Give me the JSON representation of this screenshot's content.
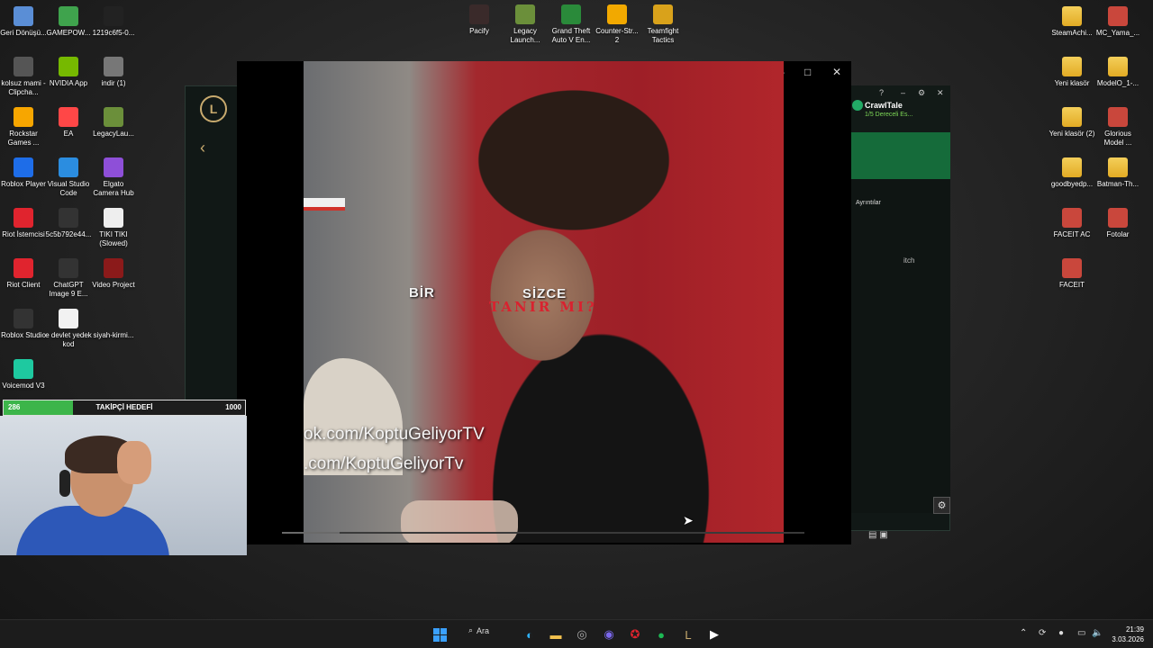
{
  "desktop_left": [
    {
      "label": "Geri Dönüşü...",
      "icon": "recycle-bin-icon",
      "color": "#5a8ed6"
    },
    {
      "label": "GAMEPOW...",
      "icon": "gamepow-icon",
      "color": "#3fa34d"
    },
    {
      "label": "1219c6f5-0...",
      "icon": "file-icon",
      "color": "#222222"
    },
    {
      "label": "kolsuz mami - Clipcha...",
      "icon": "video-file-icon",
      "color": "#555555"
    },
    {
      "label": "NVIDIA App",
      "icon": "nvidia-icon",
      "color": "#76b900"
    },
    {
      "label": "indir (1)",
      "icon": "image-file-icon",
      "color": "#777777"
    },
    {
      "label": "Rockstar Games ...",
      "icon": "rockstar-icon",
      "color": "#f7a600"
    },
    {
      "label": "EA",
      "icon": "ea-icon",
      "color": "#ff4747"
    },
    {
      "label": "LegacyLau...",
      "icon": "minecraft-icon",
      "color": "#6b8f3a"
    },
    {
      "label": "Roblox Player",
      "icon": "roblox-icon",
      "color": "#1e6de8"
    },
    {
      "label": "Visual Studio Code",
      "icon": "vscode-icon",
      "color": "#2b8de0"
    },
    {
      "label": "Elgato Camera Hub",
      "icon": "elgato-icon",
      "color": "#8e4fd8"
    },
    {
      "label": "Riot İstemcisi",
      "icon": "riot-icon",
      "color": "#e0242e"
    },
    {
      "label": "5c5b792e44...",
      "icon": "file-icon",
      "color": "#333333"
    },
    {
      "label": "TIKI TIKI (Slowed)",
      "icon": "audio-file-icon",
      "color": "#eeeeee"
    },
    {
      "label": "Riot Client",
      "icon": "riot-icon",
      "color": "#e0242e"
    },
    {
      "label": "ChatGPT Image 9 E...",
      "icon": "image-file-icon",
      "color": "#333333"
    },
    {
      "label": "Video Project",
      "icon": "video-project-icon",
      "color": "#8b1a1a"
    },
    {
      "label": "Roblox Studio",
      "icon": "roblox-studio-icon",
      "color": "#333333"
    },
    {
      "label": "e devlet yedek kod",
      "icon": "text-file-icon",
      "color": "#f2f2f2"
    },
    {
      "label": "siyah-kirmi...",
      "icon": "image-file-icon",
      "color": "#222222"
    },
    {
      "label": "Voicemod V3",
      "icon": "voicemod-icon",
      "color": "#1ec9a0"
    }
  ],
  "desktop_top": [
    {
      "label": "Pacify",
      "icon": "pacify-icon",
      "color": "#3a2a2a"
    },
    {
      "label": "Legacy Launch...",
      "icon": "minecraft-icon",
      "color": "#6b8f3a"
    },
    {
      "label": "Grand Theft Auto V En...",
      "icon": "gta-icon",
      "color": "#2a8a3a"
    },
    {
      "label": "Counter-Str... 2",
      "icon": "cs2-icon",
      "color": "#f2a900"
    },
    {
      "label": "Teamfight Tactics",
      "icon": "tft-icon",
      "color": "#d9a21b"
    }
  ],
  "desktop_right": [
    {
      "label": "SteamAchi...",
      "icon": "folder-icon"
    },
    {
      "label": "MC_Yama_...",
      "icon": "archive-icon"
    },
    {
      "label": "Yeni klasör",
      "icon": "folder-icon"
    },
    {
      "label": "ModelO_1-...",
      "icon": "folder-icon"
    },
    {
      "label": "Yeni klasör (2)",
      "icon": "folder-icon"
    },
    {
      "label": "Glorious Model ...",
      "icon": "glorious-icon"
    },
    {
      "label": "goodbyedp...",
      "icon": "folder-icon"
    },
    {
      "label": "Batman-Th...",
      "icon": "folder-icon"
    },
    {
      "label": "FACEIT AC",
      "icon": "faceit-ac-icon"
    },
    {
      "label": "Fotolar",
      "icon": "photos-icon"
    },
    {
      "label": "FACEIT",
      "icon": "faceit-icon"
    }
  ],
  "crawltale": {
    "title": "CrawlTale",
    "subtitle": "1/5 Dereceli Es...",
    "tab": "Ayrıntılar",
    "side_text": "itch"
  },
  "video": {
    "caption_left": "BİR",
    "caption_right": "SİZCE",
    "caption_red": "TANIR MI?",
    "watermark_1": "ok.com/KoptuGeliyorTV",
    "watermark_2": ".com/KoptuGeliyorTv",
    "progress": 0.11
  },
  "follower_goal": {
    "current": "286",
    "label": "TAKİPÇİ HEDEFİ",
    "target": "1000",
    "fraction": 0.286,
    "color": "#3cb54a"
  },
  "taskbar": {
    "search_label": "Ara",
    "time": "21:39",
    "date": "3.03.2026"
  }
}
